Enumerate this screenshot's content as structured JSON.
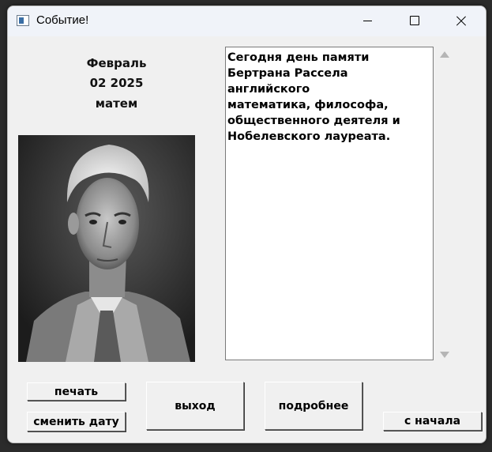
{
  "window": {
    "title": "Событие!"
  },
  "event": {
    "month": "Февраль",
    "date": "02 2025",
    "category": "матем",
    "description": "Сегодня день памяти\nБертрана Рассела английского\nматематика, философа,\nобщественного деятеля и\nНобелевского лауреата."
  },
  "buttons": {
    "print": "печать",
    "change_date": "сменить дату",
    "exit": "выход",
    "details": "подробнее",
    "restart": "с начала"
  },
  "icons": {
    "app": "app-window-icon",
    "minimize": "minimize-icon",
    "maximize": "maximize-icon",
    "close": "close-icon",
    "scroll_up": "scroll-up-arrow-icon",
    "scroll_down": "scroll-down-arrow-icon"
  }
}
